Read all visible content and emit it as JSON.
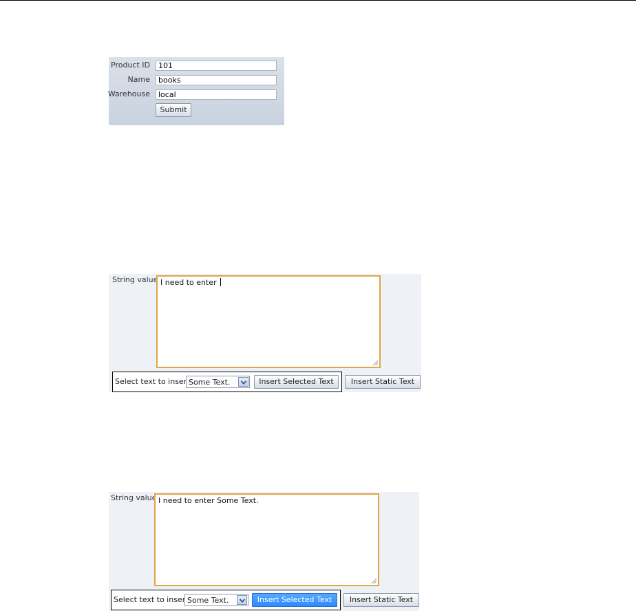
{
  "product_form": {
    "fields": [
      {
        "label": "Product ID",
        "value": "101"
      },
      {
        "label": "Name",
        "value": "books"
      },
      {
        "label": "Warehouse",
        "value": "local"
      }
    ],
    "submit_label": "Submit"
  },
  "editor_before": {
    "label": "String value",
    "text": "I need to enter ",
    "select_prompt": "Select text to insert",
    "selected_option": "Some Text.",
    "insert_selected_label": "Insert Selected Text",
    "insert_static_label": "Insert Static Text"
  },
  "editor_after": {
    "label": "String value",
    "text": "I need to enter Some Text.",
    "select_prompt": "Select text to insert",
    "selected_option": "Some Text.",
    "insert_selected_label": "Insert Selected Text",
    "insert_static_label": "Insert Static Text"
  },
  "colors": {
    "textarea_border": "#e0a544",
    "active_button": "#2d8cff",
    "panel_background": "#eef2f6"
  }
}
